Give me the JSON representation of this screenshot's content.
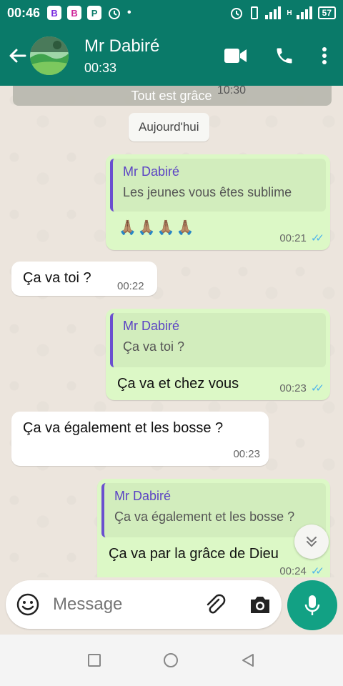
{
  "status_bar": {
    "time": "00:46",
    "badges": [
      "B",
      "B",
      "P"
    ],
    "signal_label": "H",
    "battery": "57"
  },
  "header": {
    "contact_name": "Mr Dabiré",
    "subtitle": "00:33"
  },
  "chat": {
    "sticky_preview": "Tout est grâce",
    "sticky_time": "10:30",
    "date_chip": "Aujourd'hui",
    "messages": [
      {
        "dir": "out",
        "quote_name": "Mr Dabiré",
        "quote_text": "Les jeunes vous êtes sublime",
        "text": "🙏🏽🙏🏽🙏🏽🙏🏽",
        "time": "00:21",
        "ticks": "✓✓"
      },
      {
        "dir": "in",
        "text": "Ça va toi ?",
        "time": "00:22"
      },
      {
        "dir": "out",
        "quote_name": "Mr Dabiré",
        "quote_text": "Ça va toi ?",
        "text": "Ça va et chez vous",
        "time": "00:23",
        "ticks": "✓✓"
      },
      {
        "dir": "in",
        "text": "Ça va également et les bosse ?",
        "time": "00:23"
      },
      {
        "dir": "out",
        "quote_name": "Mr Dabiré",
        "quote_text": "Ça va également et les bosse ?",
        "text": "Ça va par la grâce de Dieu",
        "time": "00:24",
        "ticks": "✓✓"
      }
    ]
  },
  "input": {
    "placeholder": "Message"
  },
  "colors": {
    "header": "#0a7a69",
    "accent": "#12a184",
    "outgoing_bubble": "#dcf8c6",
    "read_ticks": "#4fb6ec",
    "quote_accent": "#6a4fcf"
  },
  "icons": [
    "back-arrow-icon",
    "video-call-icon",
    "phone-icon",
    "more-vert-icon",
    "emoji-icon",
    "attach-icon",
    "camera-icon",
    "mic-icon",
    "chevron-double-down-icon",
    "nav-recents-icon",
    "nav-home-icon",
    "nav-back-icon"
  ]
}
